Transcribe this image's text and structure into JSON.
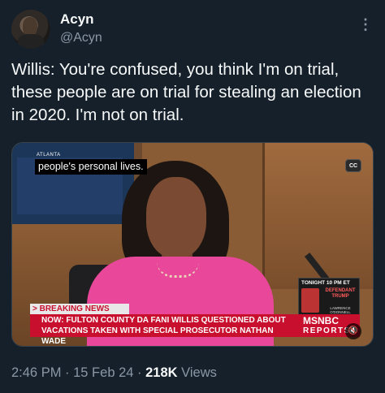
{
  "author": {
    "name": "Acyn",
    "handle": "@Acyn"
  },
  "tweet": {
    "text": "Willis: You're confused, you think I'm on trial, these people are on trial for stealing an election in 2020. I'm not on trial."
  },
  "media": {
    "caption": "people's personal lives.",
    "cc_label": "CC",
    "screen_label": "ATLANTA",
    "breaking_label": "> BREAKING NEWS",
    "ticker_text": "NOW: FULTON COUNTY DA FANI WILLIS QUESTIONED ABOUT VACATIONS TAKEN WITH SPECIAL PROSECUTOR NATHAN WADE",
    "promo_time": "TONIGHT 10 PM ET",
    "promo_title": "DEFENDANT TRUMP",
    "promo_host": "LAWRENCE O'DONNELL",
    "network_logo": "MSNBC",
    "network_reports": "REPORTS",
    "mute_icon": "speaker-muted-icon"
  },
  "meta": {
    "time": "2:46 PM",
    "separator1": " · ",
    "date": "15 Feb 24",
    "separator2": " · ",
    "views_count": "218K",
    "views_label": " Views"
  },
  "icons": {
    "more": "more-options-icon"
  }
}
